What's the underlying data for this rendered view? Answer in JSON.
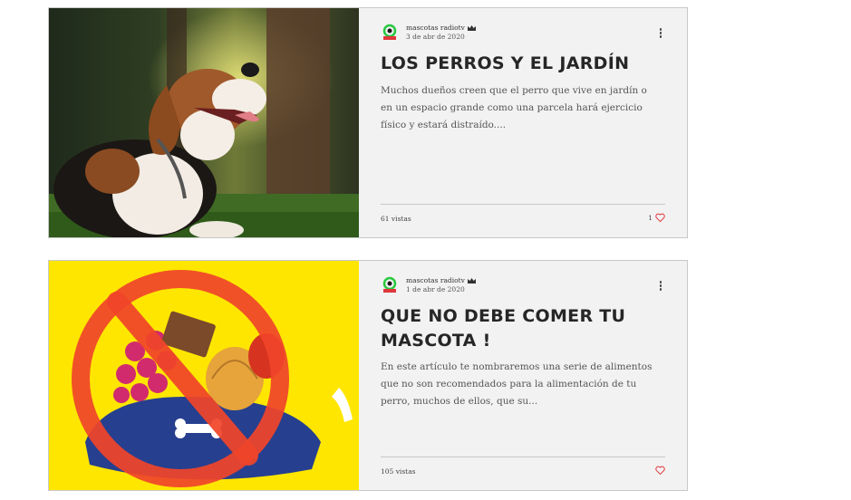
{
  "posts": [
    {
      "author": "mascotas radiotv",
      "date": "3 de abr de 2020",
      "title": "LOS PERROS Y EL JARDÍN",
      "excerpt": "Muchos dueños creen que el perro que vive en jardín o en un espacio grande como una parcela hará ejercicio físico y estará distraído....",
      "views": "61 vistas",
      "likes": "1",
      "image": "beagle-dog-photo"
    },
    {
      "author": "mascotas radiotv",
      "date": "1 de abr de 2020",
      "title": "QUE NO DEBE COMER TU MASCOTA !",
      "excerpt": "En este artículo te nombraremos una serie de alimentos que no son recomendados para la alimentación de tu perro, muchos de ellos, que su...",
      "views": "105 vistas",
      "likes": "",
      "image": "forbidden-food-illustration"
    }
  ],
  "colors": {
    "card_background": "#f2f2f2",
    "card_border": "#c8c8c8",
    "heart": "#e0363b",
    "illustration_background": "#ffe600",
    "prohibited_sign": "#f0452a"
  }
}
